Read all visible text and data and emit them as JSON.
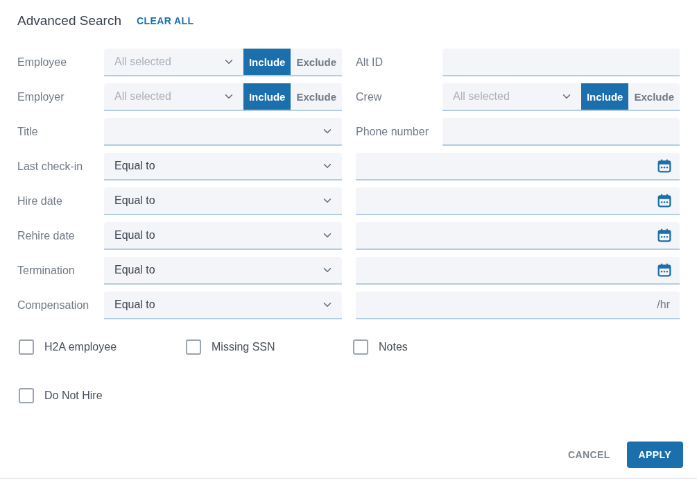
{
  "header": {
    "title": "Advanced Search",
    "clear_all": "CLEAR ALL"
  },
  "rows": [
    {
      "left": {
        "kind": "multiselect",
        "label": "Employee",
        "placeholder": "All selected",
        "modes": [
          {
            "label": "Include",
            "selected": true
          },
          {
            "label": "Exclude",
            "selected": false
          }
        ]
      },
      "right": {
        "kind": "text",
        "label": "Alt ID"
      }
    },
    {
      "left": {
        "kind": "multiselect",
        "label": "Employer",
        "placeholder": "All selected",
        "modes": [
          {
            "label": "Include",
            "selected": true
          },
          {
            "label": "Exclude",
            "selected": false
          }
        ]
      },
      "right": {
        "kind": "multiselect",
        "label": "Crew",
        "placeholder": "All selected",
        "modes": [
          {
            "label": "Include",
            "selected": true
          },
          {
            "label": "Exclude",
            "selected": false
          }
        ]
      }
    },
    {
      "left": {
        "kind": "select",
        "label": "Title"
      },
      "right": {
        "kind": "text",
        "label": "Phone number"
      }
    },
    {
      "left": {
        "kind": "select",
        "label": "Last check-in",
        "value": "Equal to"
      },
      "right": {
        "kind": "date"
      }
    },
    {
      "left": {
        "kind": "select",
        "label": "Hire date",
        "value": "Equal to"
      },
      "right": {
        "kind": "date"
      }
    },
    {
      "left": {
        "kind": "select",
        "label": "Rehire date",
        "value": "Equal to"
      },
      "right": {
        "kind": "date"
      }
    },
    {
      "left": {
        "kind": "select",
        "label": "Termination",
        "value": "Equal to"
      },
      "right": {
        "kind": "date"
      }
    },
    {
      "left": {
        "kind": "select",
        "label": "Compensation",
        "value": "Equal to"
      },
      "right": {
        "kind": "rate",
        "suffix": "/hr"
      }
    }
  ],
  "checkboxes": [
    {
      "label": "H2A employee",
      "checked": false
    },
    {
      "label": "Missing SSN",
      "checked": false
    },
    {
      "label": "Notes",
      "checked": false
    },
    {
      "label": "Do Not Hire",
      "checked": false
    }
  ],
  "buttons": [
    {
      "kind": "text",
      "label": "CANCEL"
    },
    {
      "kind": "primary",
      "label": "APPLY"
    }
  ]
}
